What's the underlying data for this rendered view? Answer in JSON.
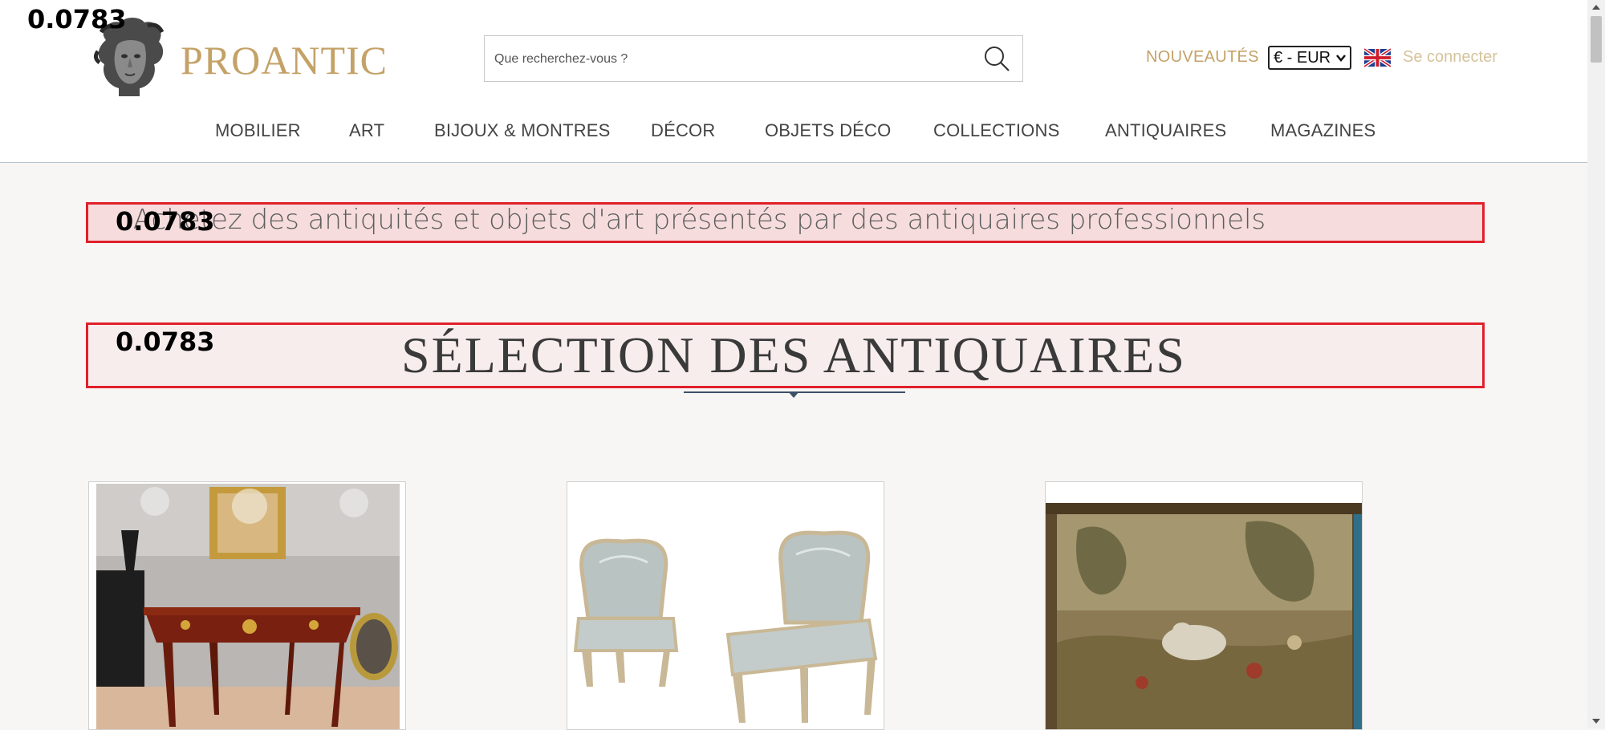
{
  "overlay_scores": {
    "logo": "0.0783",
    "tagline": "0.0783",
    "title": "0.0783"
  },
  "brand": {
    "name": "PROANTIC"
  },
  "search": {
    "placeholder": "Que recherchez-vous ?"
  },
  "header_links": {
    "new_label": "NOUVEAUTÉS",
    "currency_value": "€ - EUR",
    "login_label": "Se connecter"
  },
  "nav": {
    "items": [
      "MOBILIER",
      "ART",
      "BIJOUX & MONTRES",
      "DÉCOR",
      "OBJETS DÉCO",
      "COLLECTIONS",
      "ANTIQUAIRES",
      "MAGAZINES"
    ]
  },
  "main": {
    "tagline": "Achetez des antiquités et objets d'art présentés par des antiquaires professionnels",
    "section_title": "SÉLECTION DES ANTIQUAIRES"
  },
  "colors": {
    "accent_gold": "#c4a267",
    "highlight_red": "#e0202a",
    "divider_blue": "#3c5068"
  },
  "icons": [
    "logo-bust-icon",
    "search-icon",
    "uk-flag-icon",
    "chevron-down-icon"
  ]
}
